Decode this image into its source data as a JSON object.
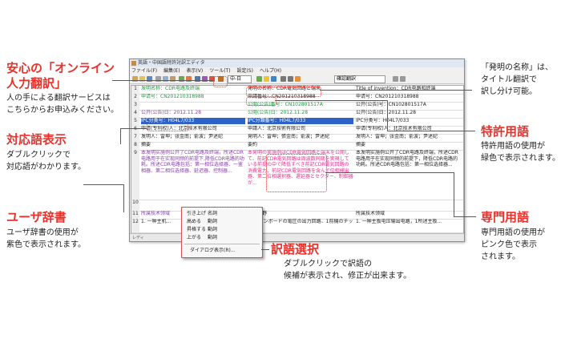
{
  "callouts": {
    "human_translation": {
      "title_line1": "安心の「オンライン",
      "title_line2": "人力翻訳」",
      "desc": "人の手による翻訳サービスは\nこちらからお申込みください。"
    },
    "counterpart": {
      "title": "対応語表示",
      "desc": "ダブルクリックで\n対応語がわかります。"
    },
    "user_dict": {
      "title": "ユーザ辞書",
      "desc": "ユーザ辞書の使用が\n紫色で表示されます。"
    },
    "invention_name": {
      "desc": "「発明の名称」は、\nタイトル翻訳で\n訳し分け可能。"
    },
    "patent_terms": {
      "title": "特許用語",
      "desc": "特許用語の使用が\n緑色で表示されます。"
    },
    "technical_terms": {
      "title": "専門用語",
      "desc": "専門用語の使用が\nピンク色で表示\nされます。"
    },
    "word_select": {
      "title": "訳語選択",
      "desc": "ダブルクリックで訳語の\n候補が表示され、修正が出来ます。"
    }
  },
  "window": {
    "title": "英語・中国語特許対訳エディタ",
    "menu": [
      "ファイル(F)",
      "編集(E)",
      "表示(V)",
      "ツール(T)",
      "設定(S)",
      "ヘルプ(H)"
    ],
    "zoom_combo": "中-日",
    "mode_combo": "確認翻訳",
    "rows": [
      {
        "n": "1",
        "c1": "发明名称：CDR电路及终端",
        "c2": "発明の名称：CDR電気回路と端末",
        "c3": "Title of invention：CDR电路和终端"
      },
      {
        "n": "2",
        "c1": "申请号：CN201210318988",
        "c2": "申請番号：CN201210318988",
        "c3": "申请号：CN201210318988"
      },
      {
        "n": "3",
        "c1": "",
        "c2": "公開(公告)番号：CN102801517A",
        "c3": "公开(公告)号：CN102801517A"
      },
      {
        "n": "4",
        "c1": "公开(公告)日：2012.11.28",
        "c2": "公開(公告)日：2012.11.28",
        "c3": "公开(公告)日：2012.11.28"
      },
      {
        "n": "5",
        "c1": "IPC分类号：H04L7/033",
        "c2": "IPC分類番号：H04L7/033",
        "c3": "IPC分类号：H04L7/033"
      },
      {
        "n": "6",
        "c1": "申请(专利权)人：北京技术有限公司",
        "c2": "申請人：北京技術有限公司",
        "c3": "申请(专利权)人：北京技术有限公司"
      },
      {
        "n": "7",
        "c1": "发明人：雷坤；张金南；俞波；尹述纪",
        "c2": "発明人：雷坤；張金南；俞波；尹述紀",
        "c3": "发明人：雷坤；张金南；俞波；尹述纪"
      },
      {
        "n": "8",
        "c1": "摘要",
        "c2": "要約",
        "c3": "摘要"
      },
      {
        "n": "9",
        "c1": "本发明实施例公开了CDR电路及终端，所述CDR电路用于在实现同频的前提下,降低CDR电路的功耗。所述CDR电路包括：第一相位选择器、一鉴相器、第二相位选择器、延迟器、控制器...",
        "c2": "本発明の実施例はCDR電気回路と端末を公開して、前記CDR電気回路は周波数同期を実現している前提の中で降低すべき前記CDR電気回路の消費電力、前記CDR電気回路を含んで位相検出器、第二位相選択器、遅延器とセクター、制御器が...",
        "c3": "本发明实施例公开了CDR电路及终端，所述CDR电路用于在实现同频的前提下，降低CDR电路的功耗。所述CDR电路包括：第一相位选择器..."
      },
      {
        "n": "10",
        "c1": "",
        "c2": "",
        "c3": ""
      },
      {
        "n": "11",
        "c1": "所属技术领域",
        "c2": "技術分野",
        "c3": "所属技术领域"
      },
      {
        "n": "12",
        "c1": "1. 一种主机...",
        "c2": "1. メインボードの電圧の出力回路、1前機のチップ...",
        "c3": "1. 一种主板电压输出电路，1所述主板..."
      }
    ],
    "status": "レディ"
  },
  "popup": {
    "items": [
      {
        "lbl": "引き上げ",
        "val": "名詞"
      },
      {
        "lbl": "高める",
        "val": "動詞"
      },
      {
        "lbl": "昇格する",
        "val": "動詞"
      },
      {
        "lbl": "上がる",
        "val": "動詞"
      }
    ],
    "dialog": "ダイアログ表示(R)..."
  }
}
